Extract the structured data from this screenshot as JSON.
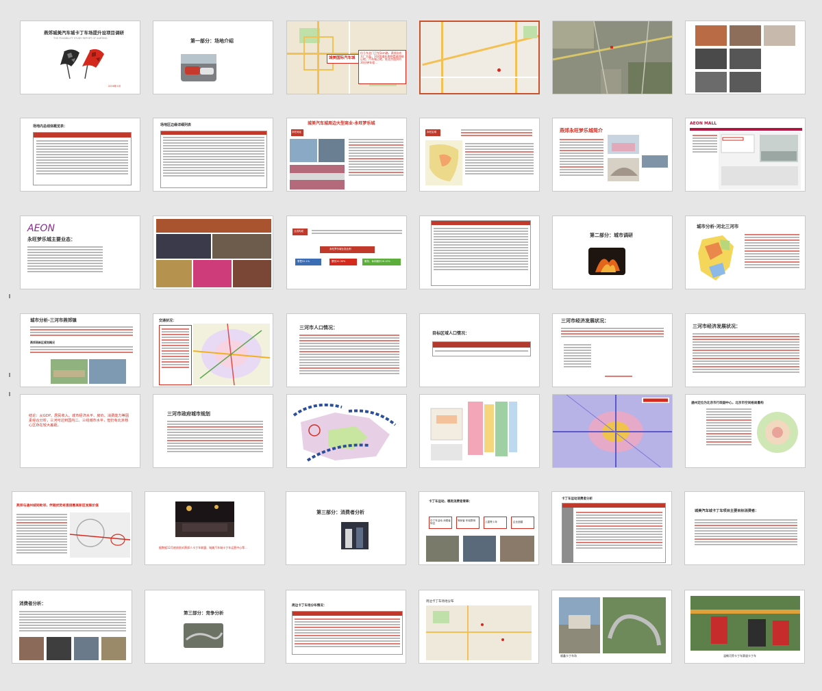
{
  "colors": {
    "background": "#e6e6e6",
    "accent_red": "#d42a1e",
    "selection_border": "#c8502a",
    "table_red": "#c0392b"
  },
  "slides": {
    "s1": {
      "title": "燕郊城美汽车城卡丁车场提升设项目调研",
      "subtitle": "THE FEASIBILITY STUDY REPORT OF KARTING",
      "footer": "2016年1月"
    },
    "s2": {
      "title": "第一部分：场地介绍"
    },
    "s3": {
      "label": "城美国际汽车城",
      "callout": "位于东北门卫东5km路，燕郊向东大厂方面，102国道东南侧是燕郊核心地，汽车城占地，距北京国贸约30分钟车程..."
    },
    "s7": {
      "title": "场地内总线体概览表："
    },
    "s8": {
      "title": "场地区边缘详细列表"
    },
    "s9": {
      "title": "城美汽车城周边大型商业-永旺梦乐城",
      "tag": "永旺地址"
    },
    "s10": {
      "tag": "永旺区域"
    },
    "s11": {
      "title": "燕郊永旺梦乐城简介"
    },
    "s12": {
      "logo": "AEON MALL"
    },
    "s13": {
      "logo": "AEON",
      "title": "永旺梦乐城主要业态："
    },
    "s15": {
      "tag": "业态构成",
      "box1": "永旺梦乐城业态比例",
      "b1": "零售52.1%",
      "b2": "餐饮20.30%",
      "b3": "服务、休闲娱乐28.10%"
    },
    "s17": {
      "title": "第二部分：城市调研"
    },
    "s18": {
      "title": "城市分析-河北三河市"
    },
    "s19": {
      "title": "城市分析-三河市燕郊镇",
      "sub": "燕郊高新区规划概况"
    },
    "s20": {
      "title": "交通状况："
    },
    "s21": {
      "title": "三河市人口情况："
    },
    "s22": {
      "title": "目标区域人口情况："
    },
    "s23": {
      "title": "三河市经济发展状况："
    },
    "s24": {
      "title": "三河市经济发展状况："
    },
    "s25": {
      "text": "结论：从GDP、居民收入、城市经济水平、房价、消费能力等因素综合分析，三河可达到国内二、三线城市水平，但仍有北京核心区存在较大差距。"
    },
    "s26": {
      "title": "三河市政府城市规划"
    },
    "s29": {
      "title": "通州定位为北京市行政副中心，北京市空间格局重构"
    },
    "s31": {
      "title": "燕郊与通州城同毗邻，伴随优势将直接惠高新区发展价值"
    },
    "s32": {
      "caption": "据数据12月底前前对燕郊人卡丁车联盟、城美汽车城卡丁车运营中心等..."
    },
    "s33": {
      "title": "第三部分：消费者分析"
    },
    "s34": {
      "title": "卡丁车运动，哪类消费者青睐：",
      "b1": "中丁车活动 消费者特征",
      "b2": "驾驶者 年轻群体",
      "b3": "儿童青少年",
      "b4": "企业团建"
    },
    "s35": {
      "title": "卡丁车运动消费者分析"
    },
    "s36": {
      "title": "城美汽车城卡丁车项目主要目标消费者："
    },
    "s37": {
      "title": "消费者分析："
    },
    "s38": {
      "title": "第三部分：竞争分析"
    },
    "s39": {
      "title": "周边卡丁车场分布情况："
    },
    "s40": {
      "title": "周边卡丁车场地分布"
    },
    "s41": {
      "caption": "顺鑫卡丁车场"
    },
    "s42": {
      "caption": "温榆河旁卡丁车赛道卡丁车"
    }
  }
}
